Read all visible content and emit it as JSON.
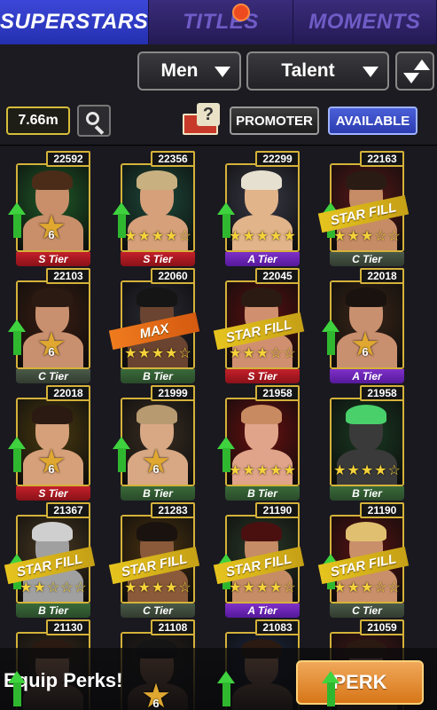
{
  "tabs": [
    {
      "label": "SUPERSTARS",
      "active": true
    },
    {
      "label": "TITLES",
      "active": false,
      "has_notification": true
    },
    {
      "label": "MOMENTS",
      "active": false
    }
  ],
  "filters": {
    "gender": "Men",
    "sort": "Talent"
  },
  "toolbar": {
    "money": "7.66m",
    "promoter_label": "PROMOTER",
    "available_label": "AVAILABLE",
    "book_icon_glyph": "?"
  },
  "cards": [
    {
      "power": "22592",
      "tier": "S Tier",
      "tier_class": "S",
      "stars": 0,
      "badge": "6",
      "ribbon": "",
      "bg": "#1f5a28",
      "skin": "#c98f6a",
      "hair": "#4a2c18",
      "upgrade": true
    },
    {
      "power": "22356",
      "tier": "S Tier",
      "tier_class": "S",
      "stars": 4,
      "badge": "",
      "ribbon": "",
      "bg": "#1e4a3a",
      "skin": "#d6a07a",
      "hair": "#c8b080",
      "upgrade": true
    },
    {
      "power": "22299",
      "tier": "A Tier",
      "tier_class": "A",
      "stars": 5,
      "badge": "",
      "ribbon": "",
      "bg": "#3a3a48",
      "skin": "#e2b48a",
      "hair": "#e6e0d0",
      "upgrade": true
    },
    {
      "power": "22163",
      "tier": "C Tier",
      "tier_class": "C",
      "stars": 3,
      "badge": "",
      "ribbon": "STAR FILL",
      "bg": "#5a1818",
      "skin": "#c68c66",
      "hair": "#2a1c14",
      "upgrade": true
    },
    {
      "power": "22103",
      "tier": "C Tier",
      "tier_class": "C",
      "stars": 0,
      "badge": "6",
      "ribbon": "",
      "bg": "#3a1e12",
      "skin": "#c99070",
      "hair": "#2a1a12",
      "upgrade": true
    },
    {
      "power": "22060",
      "tier": "B Tier",
      "tier_class": "B",
      "stars": 4,
      "badge": "",
      "ribbon": "MAX",
      "bg": "#2a2a34",
      "skin": "#6a4430",
      "hair": "#151515",
      "upgrade": false
    },
    {
      "power": "22045",
      "tier": "S Tier",
      "tier_class": "S",
      "stars": 3,
      "badge": "",
      "ribbon": "STAR FILL",
      "bg": "#5a1010",
      "skin": "#d09070",
      "hair": "#2a1a12",
      "upgrade": false
    },
    {
      "power": "22018",
      "tier": "A Tier",
      "tier_class": "A",
      "stars": 0,
      "badge": "6",
      "ribbon": "",
      "bg": "#3a2618",
      "skin": "#c99070",
      "hair": "#1a120e",
      "upgrade": true
    },
    {
      "power": "22018",
      "tier": "S Tier",
      "tier_class": "S",
      "stars": 0,
      "badge": "6",
      "ribbon": "",
      "bg": "#4a3a10",
      "skin": "#d6a07a",
      "hair": "#2a1a12",
      "upgrade": true
    },
    {
      "power": "21999",
      "tier": "B Tier",
      "tier_class": "B",
      "stars": 0,
      "badge": "6",
      "ribbon": "",
      "bg": "#3a2e22",
      "skin": "#d8a884",
      "hair": "#b89a70",
      "upgrade": true
    },
    {
      "power": "21958",
      "tier": "B Tier",
      "tier_class": "B",
      "stars": 5,
      "badge": "",
      "ribbon": "",
      "bg": "#6a1010",
      "skin": "#e0a48a",
      "hair": "#c88a60",
      "upgrade": true
    },
    {
      "power": "21958",
      "tier": "B Tier",
      "tier_class": "B",
      "stars": 4,
      "badge": "",
      "ribbon": "",
      "bg": "#1a3a22",
      "skin": "#3a3a3a",
      "hair": "#49d06a",
      "upgrade": false
    },
    {
      "power": "21367",
      "tier": "B Tier",
      "tier_class": "B",
      "stars": 2,
      "badge": "",
      "ribbon": "STAR FILL",
      "bg": "#4a3a22",
      "skin": "#a0a0a0",
      "hair": "#cfcfcf",
      "upgrade": true
    },
    {
      "power": "21283",
      "tier": "C Tier",
      "tier_class": "C",
      "stars": 4,
      "badge": "",
      "ribbon": "STAR FILL",
      "bg": "#4a3210",
      "skin": "#8a5a3a",
      "hair": "#1a120e",
      "upgrade": false
    },
    {
      "power": "21190",
      "tier": "A Tier",
      "tier_class": "A",
      "stars": 4,
      "badge": "",
      "ribbon": "STAR FILL",
      "bg": "#2a3a28",
      "skin": "#c68c66",
      "hair": "#4a1010",
      "upgrade": true
    },
    {
      "power": "21190",
      "tier": "C Tier",
      "tier_class": "C",
      "stars": 3,
      "badge": "",
      "ribbon": "STAR FILL",
      "bg": "#5a1212",
      "skin": "#c98f6a",
      "hair": "#e0c070",
      "upgrade": true
    },
    {
      "power": "21130",
      "tier": "",
      "tier_class": "C",
      "stars": 0,
      "badge": "",
      "ribbon": "",
      "bg": "#3a2e1e",
      "skin": "#c99070",
      "hair": "#2a1a12",
      "upgrade": true
    },
    {
      "power": "21108",
      "tier": "",
      "tier_class": "C",
      "stars": 0,
      "badge": "6",
      "ribbon": "",
      "bg": "#2a2420",
      "skin": "#b07a5a",
      "hair": "#151515",
      "upgrade": false
    },
    {
      "power": "21083",
      "tier": "",
      "tier_class": "C",
      "stars": 0,
      "badge": "",
      "ribbon": "",
      "bg": "#1e2a44",
      "skin": "#c99070",
      "hair": "#2a1a12",
      "upgrade": true
    },
    {
      "power": "21059",
      "tier": "",
      "tier_class": "C",
      "stars": 0,
      "badge": "",
      "ribbon": "",
      "bg": "#4a1818",
      "skin": "#c99070",
      "hair": "#2a1a12",
      "upgrade": true
    }
  ],
  "bottom": {
    "equip_text": "Equip Perks!",
    "perk_label": "PERK"
  },
  "colors": {
    "tab_active": "#2f3bc4",
    "tab_inactive": "#2a1f58",
    "notification": "#ee4a20",
    "gold_frame": "#d4b23a",
    "upgrade_arrow": "#3fd23f",
    "perk_button": "#e38a2a"
  }
}
